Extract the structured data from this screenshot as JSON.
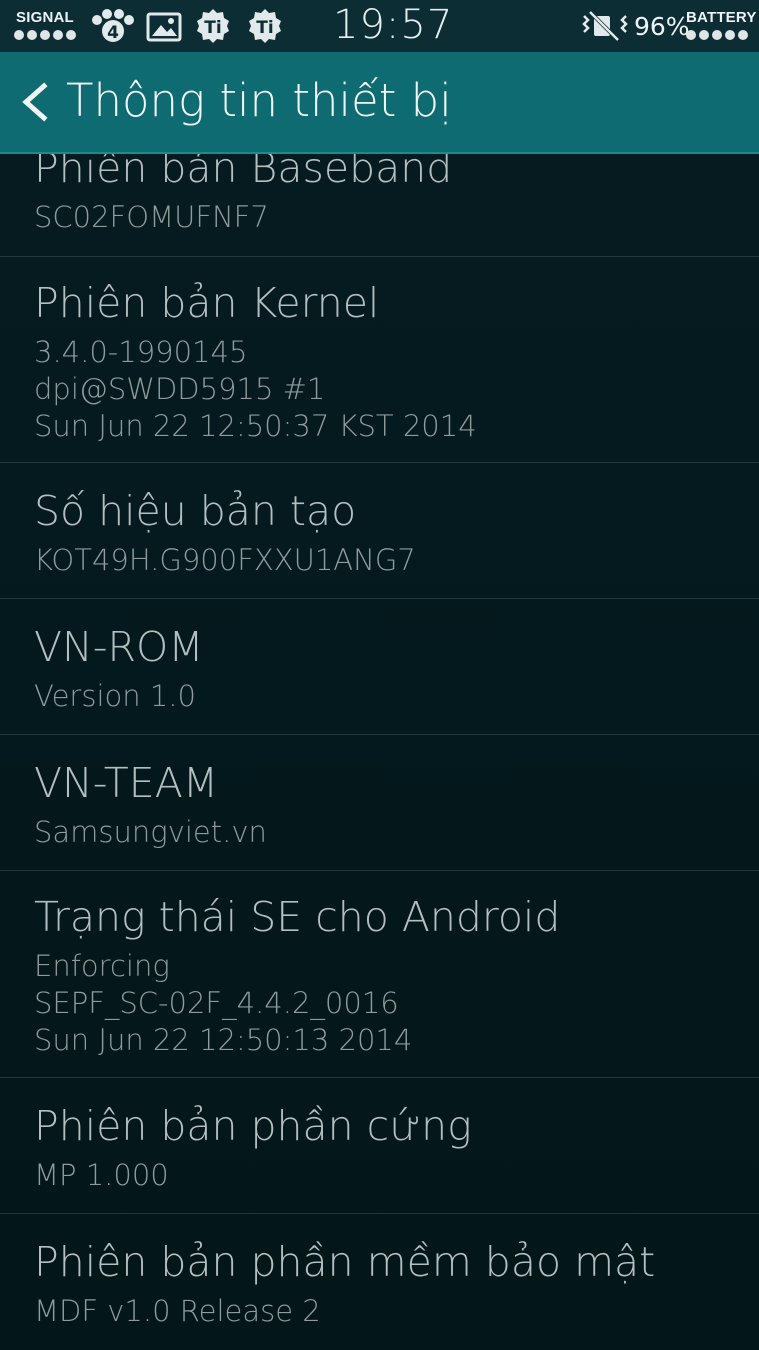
{
  "status_bar": {
    "signal_label": "SIGNAL",
    "notification_badge": "4",
    "time": "19:57",
    "battery_percent": "96%",
    "battery_label": "BATTERY",
    "icons": [
      "signal-dots-icon",
      "paw-icon",
      "image-icon",
      "ti-app-icon",
      "ti-app-icon",
      "vibrate-mute-icon",
      "battery-dots-icon"
    ]
  },
  "action_bar": {
    "back_icon": "chevron-left-icon",
    "title": "Thông tin thiết bị",
    "color": "#0f6b72"
  },
  "items": [
    {
      "title": "Phiên bản Baseband",
      "values": [
        "SC02FOMUFNF7"
      ]
    },
    {
      "title": "Phiên bản Kernel",
      "values": [
        "3.4.0-1990145",
        "dpi@SWDD5915 #1",
        "Sun Jun 22 12:50:37 KST 2014"
      ]
    },
    {
      "title": "Số hiệu bản tạo",
      "values": [
        "KOT49H.G900FXXU1ANG7"
      ]
    },
    {
      "title": "VN-ROM",
      "values": [
        "Version 1.0"
      ]
    },
    {
      "title": "VN-TEAM",
      "values": [
        "Samsungviet.vn"
      ]
    },
    {
      "title": "Trạng thái SE cho Android",
      "values": [
        "Enforcing",
        "SEPF_SC-02F_4.4.2_0016",
        "Sun Jun 22 12:50:13 2014"
      ]
    },
    {
      "title": "Phiên bản phần cứng",
      "values": [
        "MP 1.000"
      ]
    },
    {
      "title": "Phiên bản phần mềm bảo mật",
      "values": [
        "MDF v1.0 Release 2"
      ]
    }
  ]
}
